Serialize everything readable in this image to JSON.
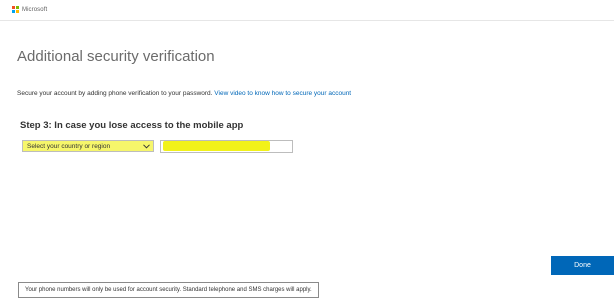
{
  "header": {
    "brand": "Microsoft",
    "logo_colors": [
      "#f25022",
      "#7fba00",
      "#00a4ef",
      "#ffb900"
    ]
  },
  "main": {
    "title": "Additional security verification",
    "intro_text": "Secure your account by adding phone verification to your password. ",
    "intro_link": "View video to know how to secure your account",
    "step_heading": "Step 3: In case you lose access to the mobile app",
    "country_select": {
      "selected": "Select your country or region"
    },
    "phone_input": {
      "value": "",
      "placeholder": ""
    },
    "done_label": "Done",
    "disclaimer": "Your phone numbers will only be used for account security. Standard telephone and SMS charges will apply."
  },
  "colors": {
    "accent": "#0067b8",
    "highlight": "#f2f21a"
  },
  "icons": {
    "select_arrow": "chevron-down-icon"
  }
}
